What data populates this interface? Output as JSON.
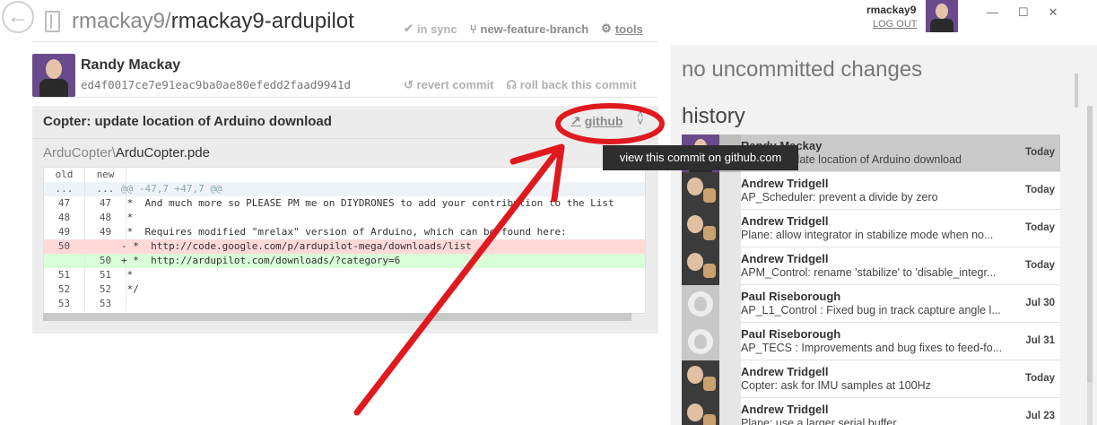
{
  "header": {
    "repo_owner": "rmackay9/",
    "repo_name": "rmackay9-ardupilot",
    "in_sync_label": "in sync",
    "branch_label": "new-feature-branch",
    "tools_label": "tools"
  },
  "commit": {
    "author": "Randy Mackay",
    "sha": "ed4f0017ce7e91eac9ba0ae80efedd2faad9941d",
    "revert_label": "revert commit",
    "rollback_label": "roll back this commit",
    "title": "Copter: update location of Arduino download",
    "github_label": "github",
    "file_dir": "ArduCopter\\",
    "file_name": "ArduCopter.pde",
    "tooltip": "view this commit on github.com"
  },
  "diff": {
    "col_old": "old",
    "col_new": "new",
    "lines": [
      {
        "type": "hunk",
        "old": "...",
        "new": "...",
        "text": "@@ -47,7 +47,7 @@"
      },
      {
        "type": "ctx",
        "old": "47",
        "new": "47",
        "text": " *  And much more so PLEASE PM me on DIYDRONES to add your contribution to the List"
      },
      {
        "type": "ctx",
        "old": "48",
        "new": "48",
        "text": " *"
      },
      {
        "type": "ctx",
        "old": "49",
        "new": "49",
        "text": " *  Requires modified \"mrelax\" version of Arduino, which can be found here:"
      },
      {
        "type": "del",
        "old": "50",
        "new": "",
        "text": "- *  http://code.google.com/p/ardupilot-mega/downloads/list"
      },
      {
        "type": "add",
        "old": "",
        "new": "50",
        "text": "+ *  http://ardupilot.com/downloads/?category=6"
      },
      {
        "type": "ctx",
        "old": "51",
        "new": "51",
        "text": " *"
      },
      {
        "type": "ctx",
        "old": "52",
        "new": "52",
        "text": " */"
      },
      {
        "type": "ctx",
        "old": "53",
        "new": "53",
        "text": ""
      }
    ]
  },
  "user": {
    "name": "rmackay9",
    "logout_label": "LOG OUT"
  },
  "window_controls": {
    "minimize": "—",
    "maximize": "☐",
    "close": "✕"
  },
  "status": {
    "no_changes": "no uncommitted changes",
    "history_title": "history"
  },
  "history": [
    {
      "author": "Randy Mackay",
      "message": "Copter: update location of Arduino download",
      "date": "Today",
      "avatar": "mackay",
      "selected": true
    },
    {
      "author": "Andrew Tridgell",
      "message": "AP_Scheduler: prevent a divide by zero",
      "date": "Today",
      "avatar": "tridge"
    },
    {
      "author": "Andrew Tridgell",
      "message": "Plane: allow integrator in stabilize mode when no...",
      "date": "Today",
      "avatar": "tridge"
    },
    {
      "author": "Andrew Tridgell",
      "message": "APM_Control: rename 'stabilize' to 'disable_integr...",
      "date": "Today",
      "avatar": "tridge"
    },
    {
      "author": "Paul Riseborough",
      "message": "AP_L1_Control : Fixed bug in track capture angle l...",
      "date": "Jul 30",
      "avatar": "octo"
    },
    {
      "author": "Paul Riseborough",
      "message": "AP_TECS : Improvements and bug fixes to feed-fo...",
      "date": "Jul 31",
      "avatar": "octo"
    },
    {
      "author": "Andrew Tridgell",
      "message": "Copter: ask for IMU samples at 100Hz",
      "date": "Today",
      "avatar": "tridge"
    },
    {
      "author": "Andrew Tridgell",
      "message": "Plane: use a larger serial buffer",
      "date": "Jul 23",
      "avatar": "tridge"
    }
  ],
  "colors": {
    "annotation_red": "#e0191f",
    "del_bg": "#ffd8d8",
    "add_bg": "#d8ffd8",
    "selected_bg": "#c9c9c9"
  },
  "icons": {
    "back": "back-arrow-icon",
    "repo": "repo-icon",
    "sync": "check-icon",
    "branch": "branch-icon",
    "tools": "gear-icon",
    "revert": "revert-icon",
    "rollback": "rollback-icon",
    "github": "external-link-icon",
    "collapse": "collapse-icon"
  }
}
